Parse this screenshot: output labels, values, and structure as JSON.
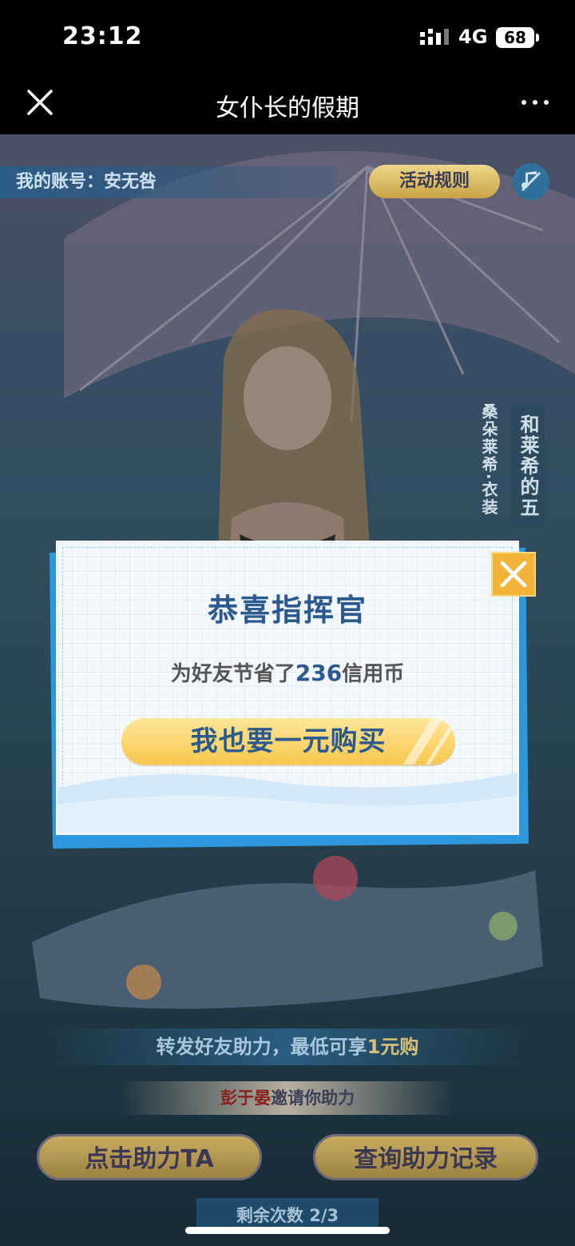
{
  "status_bar": {
    "time": "23:12",
    "network": "4G",
    "battery": "68"
  },
  "header": {
    "title": "女仆长的假期"
  },
  "event": {
    "account_label": "我的账号：安无咎",
    "rules_button": "活动规则",
    "side_text_small": "桑朵莱希·衣装",
    "side_text_large": "和莱希的五",
    "share_tip_prefix": "转发好友助力，最低可享",
    "share_tip_highlight": "1元购",
    "inviter_name": "彭于晏",
    "invite_suffix": "邀请你助力",
    "help_button": "点击助力TA",
    "record_button": "查询助力记录",
    "remaining_label": "剩余次数 2/3"
  },
  "modal": {
    "title": "恭喜指挥官",
    "message_prefix": "为好友节省了",
    "saved_amount": "236",
    "message_suffix": "信用币",
    "buy_button": "我也要一元购买"
  }
}
